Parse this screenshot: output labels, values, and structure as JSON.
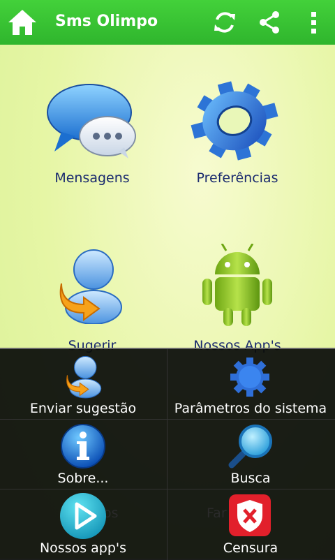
{
  "app": {
    "title": "Sms Olimpo"
  },
  "toolbar": {
    "icons": [
      "home-icon",
      "refresh-icon",
      "share-icon",
      "overflow-menu-icon"
    ]
  },
  "tiles": [
    {
      "label": "Mensagens",
      "icon": "chat-bubbles-icon"
    },
    {
      "label": "Preferências",
      "icon": "gear-icon"
    },
    {
      "label": "Sugerir",
      "icon": "user-arrow-icon"
    },
    {
      "label": "Nossos App's",
      "icon": "android-robot-icon"
    }
  ],
  "hidden_behind_menu": [
    "os",
    "Far"
  ],
  "menu": {
    "items": [
      {
        "label": "Enviar sugestão",
        "icon": "user-arrow-icon"
      },
      {
        "label": "Parâmetros do sistema",
        "icon": "gear-icon"
      },
      {
        "label": "Sobre...",
        "icon": "info-icon"
      },
      {
        "label": "Busca",
        "icon": "magnifier-icon"
      },
      {
        "label": "Nossos app's",
        "icon": "play-store-icon"
      },
      {
        "label": "Censura",
        "icon": "shield-x-icon"
      }
    ]
  },
  "colors": {
    "toolbar": "#35bd31",
    "background": "#e6f6a5",
    "label_text": "#1a2a6e",
    "menu_bg": "#0a0c0a"
  }
}
